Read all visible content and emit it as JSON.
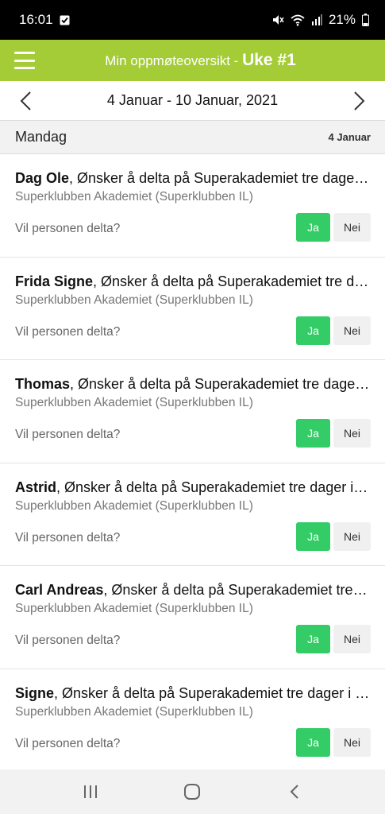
{
  "status_bar": {
    "time": "16:01",
    "battery": "21%",
    "icons": [
      "checkbox-notification-icon",
      "mute-icon",
      "wifi-icon",
      "signal-icon",
      "battery-icon"
    ]
  },
  "app_bar": {
    "title": "Min oppmøteoversikt - ",
    "week": "Uke #1",
    "background": "#a4cc37"
  },
  "date_nav": {
    "range": "4 Januar - 10 Januar, 2021",
    "prev_icon": "chevron-left-icon",
    "next_icon": "chevron-right-icon"
  },
  "day": {
    "name": "Mandag",
    "date": "4 Januar"
  },
  "items": [
    {
      "name": "Dag Ole",
      "text": ", Ønsker å delta på Superakademiet tre dager i uken",
      "club": "Superklubben Akademiet (Superklubben IL)",
      "question": "Vil personen delta?",
      "yes": "Ja",
      "no": "Nei"
    },
    {
      "name": "Frida Signe",
      "text": ", Ønsker å delta på Superakademiet tre dager i uken",
      "club": "Superklubben Akademiet (Superklubben IL)",
      "question": "Vil personen delta?",
      "yes": "Ja",
      "no": "Nei"
    },
    {
      "name": "Thomas",
      "text": ", Ønsker å delta på Superakademiet tre dager i uken",
      "club": "Superklubben Akademiet (Superklubben IL)",
      "question": "Vil personen delta?",
      "yes": "Ja",
      "no": "Nei"
    },
    {
      "name": "Astrid",
      "text": ", Ønsker å delta på Superakademiet tre dager i uken",
      "club": "Superklubben Akademiet (Superklubben IL)",
      "question": "Vil personen delta?",
      "yes": "Ja",
      "no": "Nei"
    },
    {
      "name": "Carl Andreas",
      "text": ", Ønsker å delta på Superakademiet tre dager i uken",
      "club": "Superklubben Akademiet (Superklubben IL)",
      "question": "Vil personen delta?",
      "yes": "Ja",
      "no": "Nei"
    },
    {
      "name": "Signe",
      "text": ", Ønsker å delta på Superakademiet tre dager i uken",
      "club": "Superklubben Akademiet (Superklubben IL)",
      "question": "Vil personen delta?",
      "yes": "Ja",
      "no": "Nei"
    }
  ],
  "colors": {
    "accent": "#a4cc37",
    "yes_button": "#33cc66"
  },
  "bottom_nav": {
    "icons": [
      "recent-apps-icon",
      "home-icon",
      "back-icon"
    ]
  }
}
